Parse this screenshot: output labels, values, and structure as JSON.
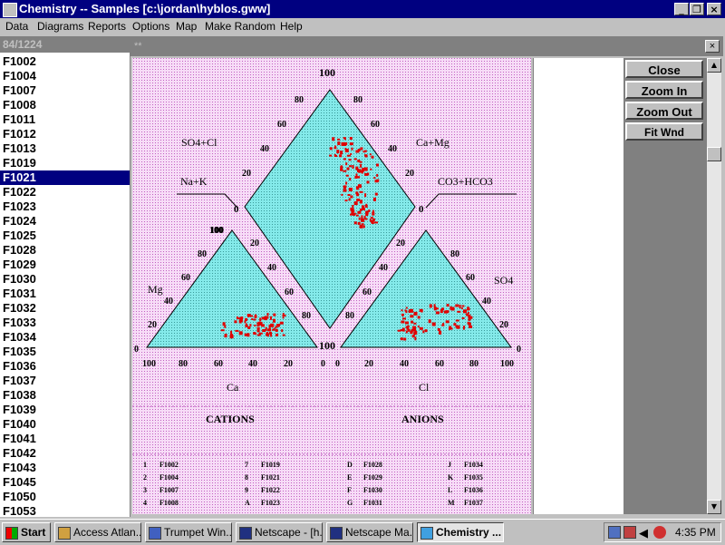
{
  "window": {
    "title": "Chemistry -- Samples [c:\\jordan\\hyblos.gww]"
  },
  "menu": [
    "Data",
    "Diagrams",
    "Reports",
    "Options",
    "Map",
    "Make Random",
    "Help"
  ],
  "left_panel": {
    "header": "84/1224",
    "items": [
      "F1002",
      "F1004",
      "F1007",
      "F1008",
      "F1011",
      "F1012",
      "F1013",
      "F1019",
      "F1021",
      "F1022",
      "F1023",
      "F1024",
      "F1025",
      "F1028",
      "F1029",
      "F1030",
      "F1031",
      "F1032",
      "F1033",
      "F1034",
      "F1035",
      "F1036",
      "F1037",
      "F1038",
      "F1039",
      "F1040",
      "F1041",
      "F1042",
      "F1043",
      "F1045",
      "F1050",
      "F1053"
    ],
    "selected": "F1021"
  },
  "child_window": {
    "title": "**"
  },
  "buttons": {
    "close": "Close",
    "zoom_in": "Zoom In",
    "zoom_out": "Zoom Out",
    "fit": "Fit Wnd"
  },
  "piper": {
    "diamond": {
      "top": "100",
      "left": "0",
      "right": "0",
      "bottom": "100",
      "left_label": "SO4+Cl",
      "right_label": "Ca+Mg",
      "na_k": "Na+K",
      "co3": "CO3+HCO3"
    },
    "cation_label": "Ca",
    "anion_label": "Cl",
    "mg_label": "Mg",
    "so4_label": "SO4",
    "section_cations": "CATIONS",
    "section_anions": "ANIONS",
    "ticks": [
      "20",
      "40",
      "60",
      "80",
      "100"
    ]
  },
  "legend": [
    [
      "1",
      "F1002"
    ],
    [
      "7",
      "F1019"
    ],
    [
      "D",
      "F1028"
    ],
    [
      "J",
      "F1034"
    ],
    [
      "2",
      "F1004"
    ],
    [
      "8",
      "F1021"
    ],
    [
      "E",
      "F1029"
    ],
    [
      "K",
      "F1035"
    ],
    [
      "3",
      "F1007"
    ],
    [
      "9",
      "F1022"
    ],
    [
      "F",
      "F1030"
    ],
    [
      "L",
      "F1036"
    ],
    [
      "4",
      "F1008"
    ],
    [
      "A",
      "F1023"
    ],
    [
      "G",
      "F1031"
    ],
    [
      "M",
      "F1037"
    ]
  ],
  "colors": {
    "titlebar": "#000080",
    "plot_bg": "#f2c6f2",
    "fill": "#7de8e8",
    "points": "#e00000"
  },
  "taskbar": {
    "start": "Start",
    "items": [
      "Access Atlan...",
      "Trumpet Win...",
      "Netscape - [h...",
      "Netscape Ma...",
      "Chemistry ..."
    ],
    "clock": "4:35 PM"
  }
}
